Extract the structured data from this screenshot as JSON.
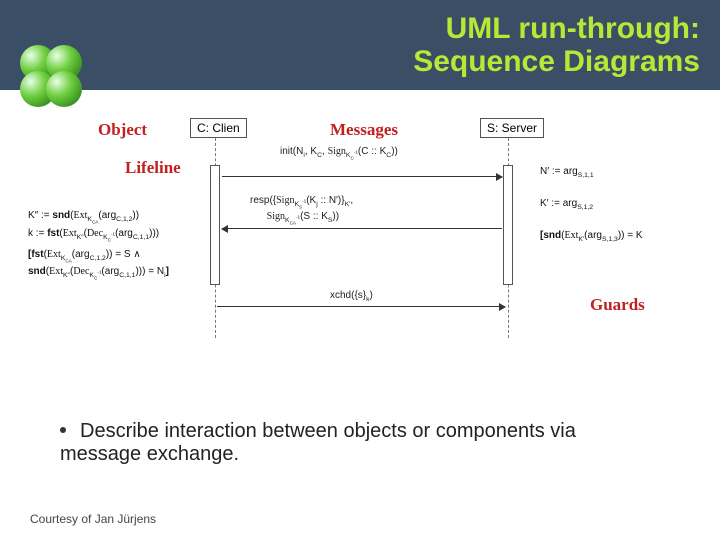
{
  "header": {
    "title_line1": "UML run-through:",
    "title_line2": "Sequence Diagrams"
  },
  "labels": {
    "object": "Object",
    "messages": "Messages",
    "lifeline": "Lifeline",
    "guards": "Guards"
  },
  "objects": {
    "client": "C: Clien",
    "server": "S: Server"
  },
  "messages": {
    "init": "init(Nᵢ, K_C, Sign_{K_C}⁻¹(C :: K_C))",
    "resp": "resp({Sign_{K_S}⁻¹(K_j :: N′)}_{K′}, Sign_{K_{CA}}⁻¹(S :: K_S))",
    "xchd": "xchd({s}_k)"
  },
  "left_notes": {
    "k2": "K″ := snd(𝓔xt_{K_{CA}}(arg_{C,1,2}))",
    "k": "k := fst(𝓔xt_{K″}(𝓓ec_{K_C}⁻¹(arg_{C,1,1})))",
    "guard": "[fst(𝓔xt_{K_{CA}}(arg_{C,1,2})) = S ∧ snd(𝓔xt_{K″}(𝓓ec_{K_C}⁻¹(arg_{C,1,1}))) = Nᵢ]"
  },
  "right_notes": {
    "n": "N′ := arg_{S,1,1}",
    "k": "K′ := arg_{S,1,2}",
    "guard": "[snd(𝓔xt_{K′}(arg_{S,1,3})) = K"
  },
  "bullet": "Describe interaction between objects or components via message exchange.",
  "footer": "Courtesy of Jan Jürjens"
}
